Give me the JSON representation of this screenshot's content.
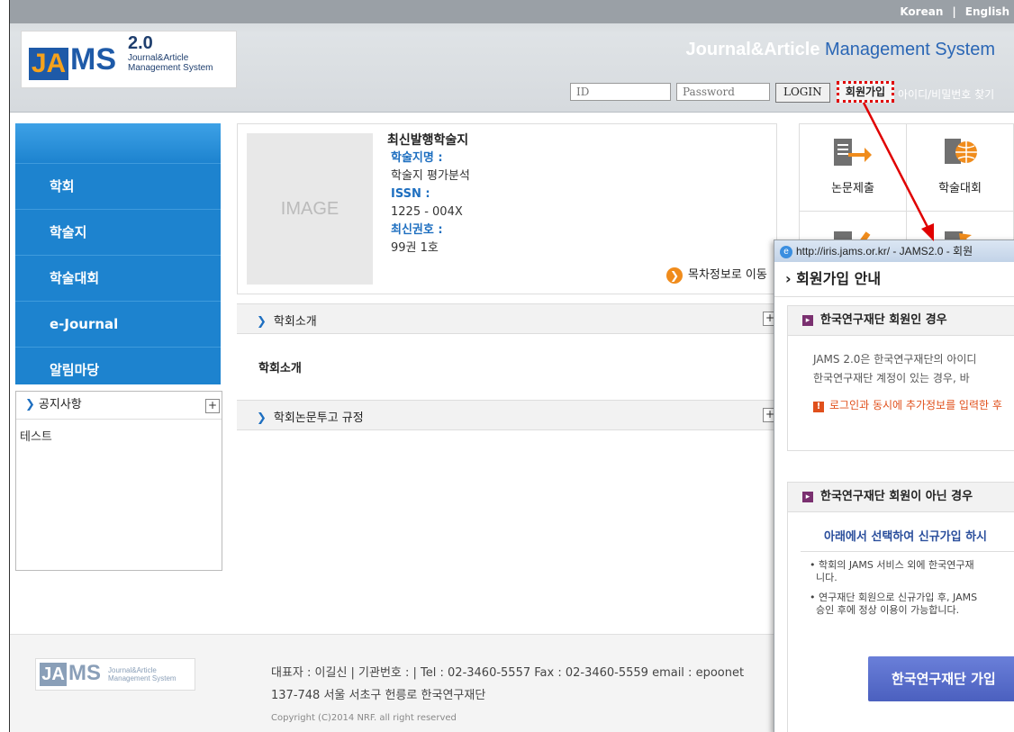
{
  "header": {
    "lang_korean": "Korean",
    "lang_sep": "|",
    "lang_english": "English",
    "logo": {
      "ja": "JA",
      "ms": "MS",
      "version": "2.0",
      "sub": "Journal&Article Management System"
    },
    "system_title_a": "Journal&Article",
    "system_title_b": "Management System",
    "id_placeholder": "ID",
    "password_placeholder": "Password",
    "login_label": "LOGIN",
    "signup_label": "회원가입",
    "find_label": "아이디/비밀번호 찾기"
  },
  "nav": {
    "items": [
      "학회",
      "학술지",
      "학술대회",
      "e-Journal",
      "알림마당"
    ]
  },
  "notice": {
    "title": "공지사항",
    "entries": [
      "테스트"
    ]
  },
  "latest": {
    "heading": "최신발행학술지",
    "image_placeholder": "IMAGE",
    "journal_label": "학술지명 :",
    "journal_value": "학술지 평가분석",
    "issn_label": "ISSN :",
    "issn_value": "1225 - 004X",
    "issue_label": "최신권호 :",
    "issue_value": "99권  1호",
    "toc_link": "목차정보로 이동"
  },
  "sections": {
    "intro_header": "학회소개",
    "intro_body": "학회소개",
    "rules_header": "학회논문투고 규정"
  },
  "tiles": [
    "논문제출",
    "학술대회"
  ],
  "footer": {
    "logo": {
      "ja": "JA",
      "ms": "MS",
      "sub": "Journal&Article Management System"
    },
    "info_line": "대표자 : 이길신 | 기관번호 : | Tel : 02-3460-5557  Fax : 02-3460-5559  email : epoonet",
    "address": "137-748 서울 서초구 헌릉로 한국연구재단",
    "copyright": "Copyright (C)2014 NRF. all right reserved"
  },
  "popup": {
    "titlebar": "http://iris.jams.or.kr/ - JAMS2.0 - 회원",
    "title": "› 회원가입 안내",
    "box1_header": "한국연구재단 회원인 경우",
    "box1_text1": "JAMS 2.0은 한국연구재단의 아이디",
    "box1_text2": "한국연구재단 계정이 있는 경우, 바",
    "box1_warn": "로그인과 동시에 추가정보를 입력한 후",
    "box2_header": "한국연구재단 회원이 아닌 경우",
    "box2_select": "아래에서 선택하여 신규가입 하시",
    "box2_b1a": "학회의 JAMS 서비스 외에 한국연구재",
    "box2_b1b": "니다.",
    "box2_b2a": "연구재단 회원으로 신규가입 후, JAMS",
    "box2_b2b": "승인 후에 정상 이용이 가능합니다.",
    "join_button": "한국연구재단 가입"
  },
  "colors": {
    "nav_blue": "#1d83cf",
    "accent_blue": "#1e6fc0",
    "signup_highlight": "#e00000",
    "join_button": "#5a6fd0"
  }
}
